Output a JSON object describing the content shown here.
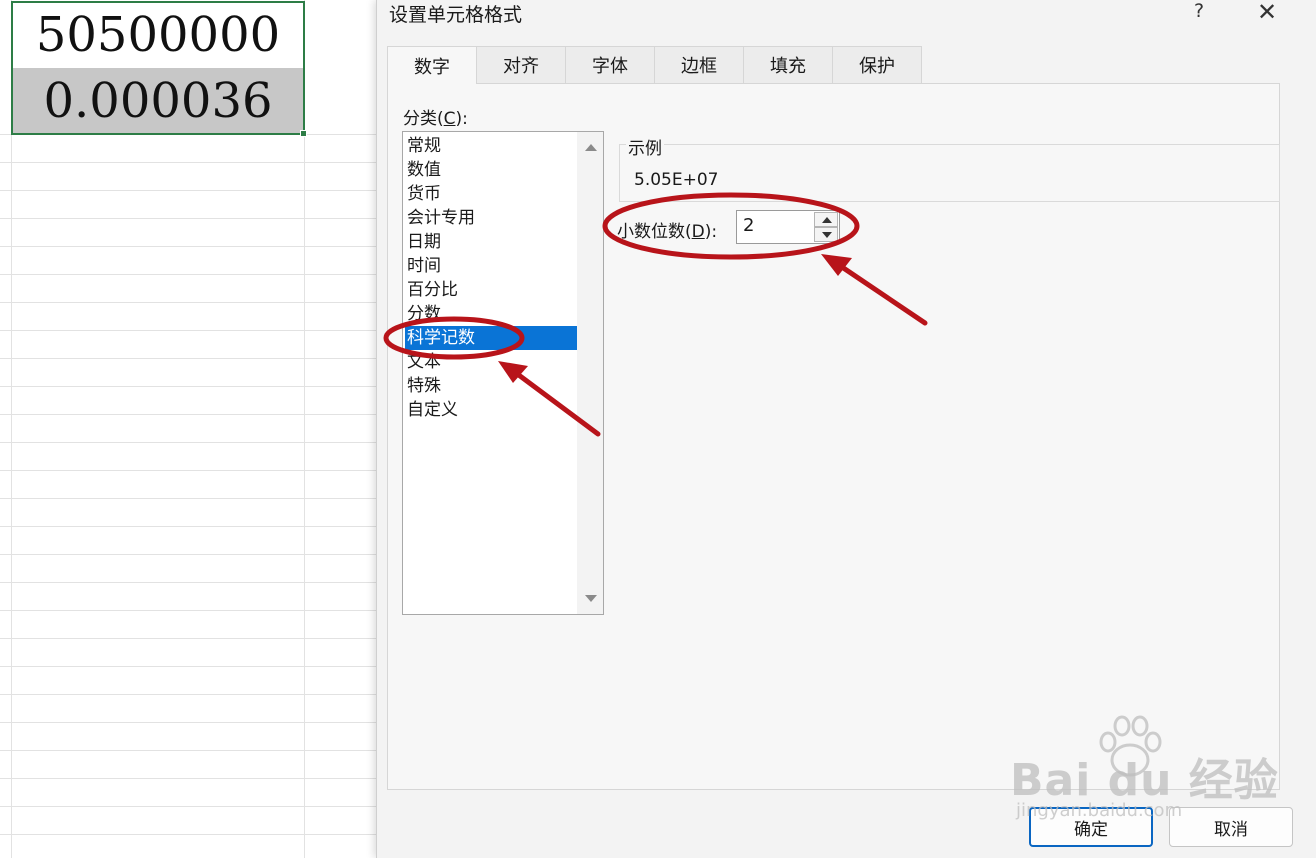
{
  "spreadsheet": {
    "cells": [
      "50500000",
      "0.000036"
    ]
  },
  "dialog": {
    "title": "设置单元格格式",
    "help": "?",
    "close": "✕",
    "tabs": [
      "数字",
      "对齐",
      "字体",
      "边框",
      "填充",
      "保护"
    ],
    "active_tab": "数字",
    "category": {
      "label_prefix": "分类(",
      "label_key": "C",
      "label_suffix": "):",
      "items": [
        "常规",
        "数值",
        "货币",
        "会计专用",
        "日期",
        "时间",
        "百分比",
        "分数",
        "科学记数",
        "文本",
        "特殊",
        "自定义"
      ],
      "selected": "科学记数"
    },
    "sample": {
      "label": "示例",
      "value": "5.05E+07"
    },
    "decimal_places": {
      "label_prefix": "小数位数(",
      "label_key": "D",
      "label_suffix": "):",
      "value": "2"
    },
    "buttons": {
      "ok": "确定",
      "cancel": "取消"
    }
  },
  "watermark": {
    "brand": "Bai du 经验",
    "url": "jingyan.baidu.com"
  },
  "colors": {
    "selection_blue": "#0a74d6",
    "annotation_red": "#b8141a",
    "cell_border_green": "#2d7d46"
  }
}
